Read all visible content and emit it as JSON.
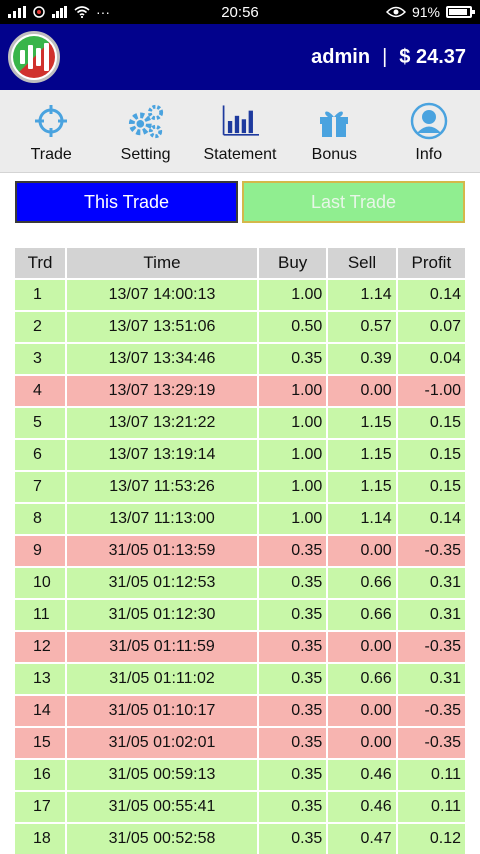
{
  "status_bar": {
    "time": "20:56",
    "battery_percent": "91%",
    "battery_level": 0.91,
    "dots": "···"
  },
  "header": {
    "username": "admin",
    "separator": "|",
    "balance": "$ 24.37"
  },
  "nav": {
    "items": [
      {
        "label": "Trade",
        "icon": "crosshair-icon"
      },
      {
        "label": "Setting",
        "icon": "gears-icon"
      },
      {
        "label": "Statement",
        "icon": "bar-chart-icon"
      },
      {
        "label": "Bonus",
        "icon": "gift-icon"
      },
      {
        "label": "Info",
        "icon": "user-icon"
      }
    ]
  },
  "tabs": {
    "this_trade": "This Trade",
    "last_trade": "Last Trade"
  },
  "colors": {
    "header_bg": "#02028c",
    "active_tab": "#0000ff",
    "inactive_tab": "#90ee90",
    "gain_row": "#c8f7a8",
    "loss_row": "#f7b4b0",
    "icon_blue": "#4aa3df",
    "icon_dark": "#1e3a9e"
  },
  "table": {
    "headers": [
      "Trd",
      "Time",
      "Buy",
      "Sell",
      "Profit"
    ],
    "rows": [
      {
        "trd": "1",
        "time": "13/07 14:00:13",
        "buy": "1.00",
        "sell": "1.14",
        "profit": "0.14",
        "status": "gain"
      },
      {
        "trd": "2",
        "time": "13/07 13:51:06",
        "buy": "0.50",
        "sell": "0.57",
        "profit": "0.07",
        "status": "gain"
      },
      {
        "trd": "3",
        "time": "13/07 13:34:46",
        "buy": "0.35",
        "sell": "0.39",
        "profit": "0.04",
        "status": "gain"
      },
      {
        "trd": "4",
        "time": "13/07 13:29:19",
        "buy": "1.00",
        "sell": "0.00",
        "profit": "-1.00",
        "status": "loss"
      },
      {
        "trd": "5",
        "time": "13/07 13:21:22",
        "buy": "1.00",
        "sell": "1.15",
        "profit": "0.15",
        "status": "gain"
      },
      {
        "trd": "6",
        "time": "13/07 13:19:14",
        "buy": "1.00",
        "sell": "1.15",
        "profit": "0.15",
        "status": "gain"
      },
      {
        "trd": "7",
        "time": "13/07 11:53:26",
        "buy": "1.00",
        "sell": "1.15",
        "profit": "0.15",
        "status": "gain"
      },
      {
        "trd": "8",
        "time": "13/07 11:13:00",
        "buy": "1.00",
        "sell": "1.14",
        "profit": "0.14",
        "status": "gain"
      },
      {
        "trd": "9",
        "time": "31/05 01:13:59",
        "buy": "0.35",
        "sell": "0.00",
        "profit": "-0.35",
        "status": "loss"
      },
      {
        "trd": "10",
        "time": "31/05 01:12:53",
        "buy": "0.35",
        "sell": "0.66",
        "profit": "0.31",
        "status": "gain"
      },
      {
        "trd": "11",
        "time": "31/05 01:12:30",
        "buy": "0.35",
        "sell": "0.66",
        "profit": "0.31",
        "status": "gain"
      },
      {
        "trd": "12",
        "time": "31/05 01:11:59",
        "buy": "0.35",
        "sell": "0.00",
        "profit": "-0.35",
        "status": "loss"
      },
      {
        "trd": "13",
        "time": "31/05 01:11:02",
        "buy": "0.35",
        "sell": "0.66",
        "profit": "0.31",
        "status": "gain"
      },
      {
        "trd": "14",
        "time": "31/05 01:10:17",
        "buy": "0.35",
        "sell": "0.00",
        "profit": "-0.35",
        "status": "loss"
      },
      {
        "trd": "15",
        "time": "31/05 01:02:01",
        "buy": "0.35",
        "sell": "0.00",
        "profit": "-0.35",
        "status": "loss"
      },
      {
        "trd": "16",
        "time": "31/05 00:59:13",
        "buy": "0.35",
        "sell": "0.46",
        "profit": "0.11",
        "status": "gain"
      },
      {
        "trd": "17",
        "time": "31/05 00:55:41",
        "buy": "0.35",
        "sell": "0.46",
        "profit": "0.11",
        "status": "gain"
      },
      {
        "trd": "18",
        "time": "31/05 00:52:58",
        "buy": "0.35",
        "sell": "0.47",
        "profit": "0.12",
        "status": "gain"
      }
    ]
  }
}
